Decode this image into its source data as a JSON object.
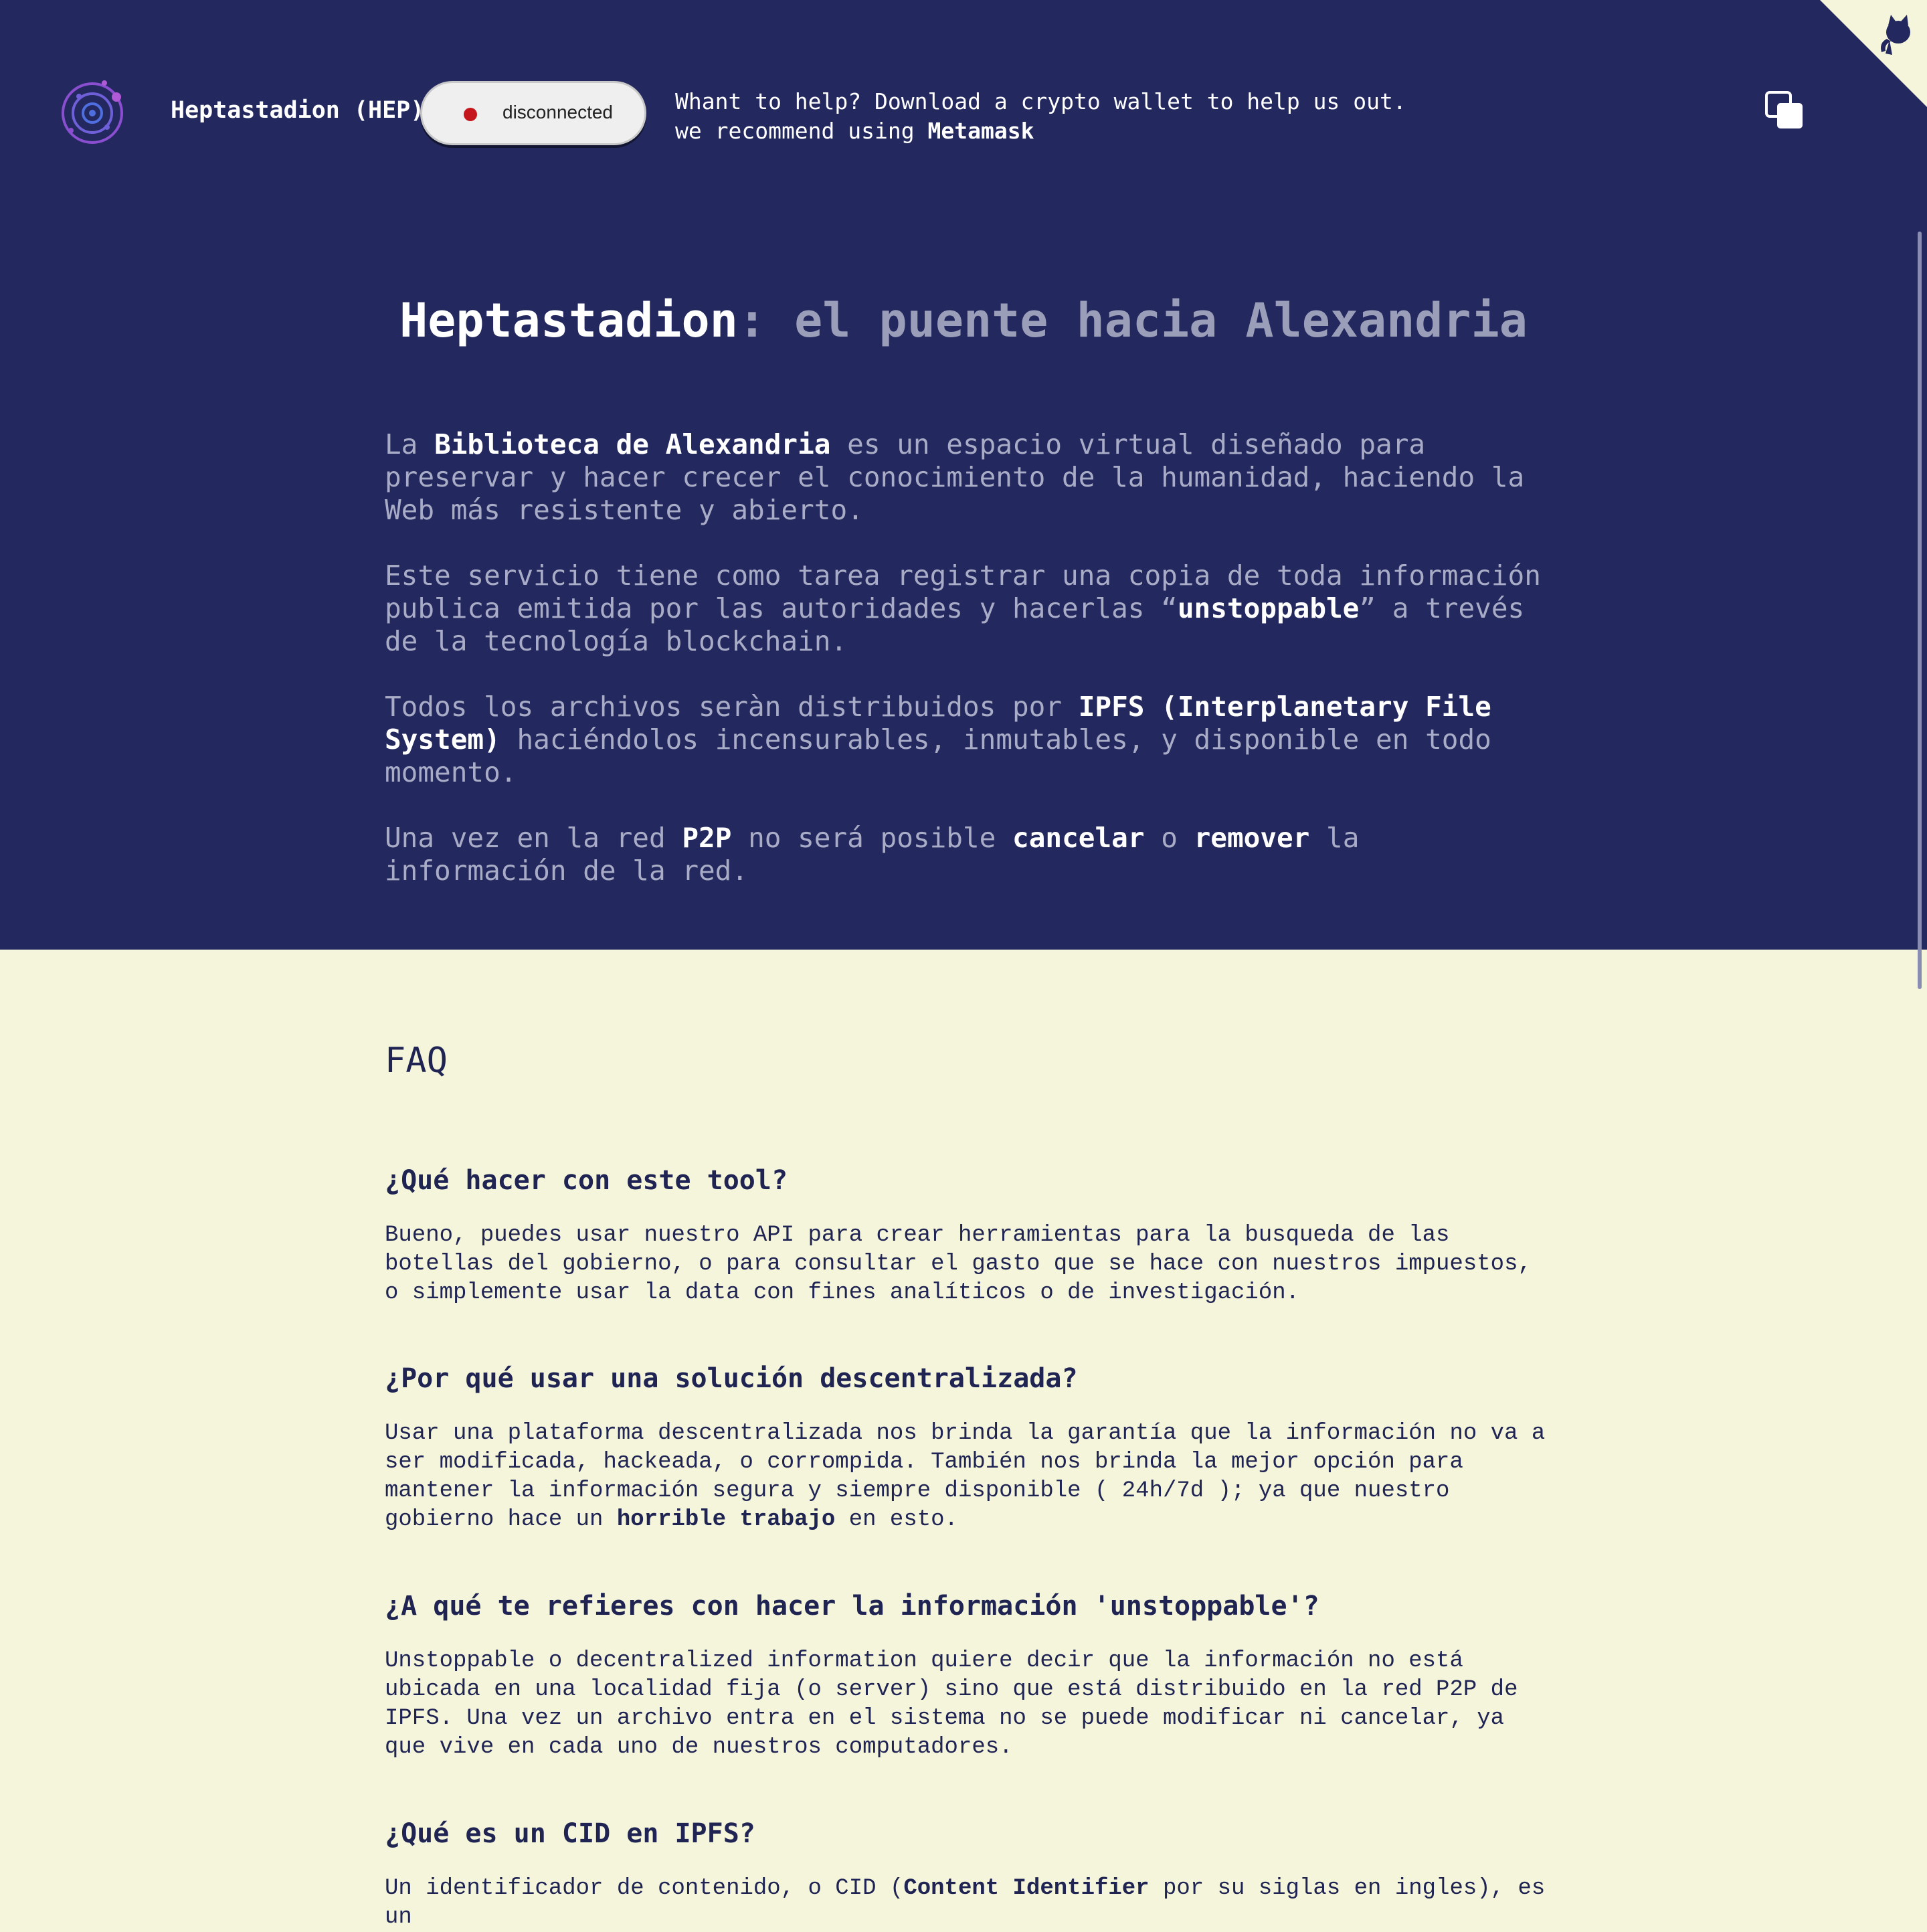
{
  "header": {
    "brand": "Heptastadion (HEP)",
    "status": "disconnected",
    "status_color": "#c4161c",
    "help_line1": "Whant to help? Download a crypto wallet to help us out.",
    "help_line2_prefix": "we recommend using ",
    "help_link": "Metamask",
    "copy_icon": "copy-icon",
    "corner_icon": "github-octocat-icon"
  },
  "hero": {
    "title_strong": "Heptastadion",
    "title_rest": ": el puente hacia Alexandria",
    "p1_pre": "La ",
    "p1_b": "Biblioteca de Alexandria",
    "p1_post": " es un espacio virtual diseñado para preservar y hacer crecer el conocimiento de la humanidad, haciendo la Web más resistente y abierto.",
    "p2_pre": "Este servicio tiene como tarea registrar una copia de toda información publica emitida por las autoridades y hacerlas “",
    "p2_b": "unstoppable",
    "p2_post": "” a trevés de la tecnología blockchain.",
    "p3_pre": "Todos los archivos seràn distribuidos por ",
    "p3_b": "IPFS (Interplanetary File System)",
    "p3_post": " haciéndolos incensurables, inmutables, y disponible en todo momento.",
    "p4_pre": "Una vez en la red ",
    "p4_b1": "P2P",
    "p4_mid1": " no será posible ",
    "p4_b2": "cancelar",
    "p4_mid2": " o ",
    "p4_b3": "remover",
    "p4_post": " la información de la red."
  },
  "faq": {
    "title": "FAQ",
    "q1": "¿Qué hacer con este tool?",
    "a1": "Bueno, puedes usar nuestro API para crear herramientas para la busqueda de las botellas del gobierno, o para consultar el gasto que se hace con nuestros impuestos, o simplemente usar la data con fines analíticos o de investigación.",
    "q2": "¿Por qué usar una solución descentralizada?",
    "a2_pre": "Usar una plataforma descentralizada nos brinda la garantía que la información no va a ser modificada, hackeada, o corrompida. También nos brinda la mejor opción para mantener la información segura y siempre disponible ( 24h/7d ); ya que nuestro gobierno hace un ",
    "a2_b": "horrible trabajo",
    "a2_post": " en esto.",
    "q3": "¿A qué te refieres con hacer la información 'unstoppable'?",
    "a3": "Unstoppable o decentralized information quiere decir que la información no está ubicada en una localidad fija (o server) sino que está distribuido en la red P2P de IPFS. Una vez un archivo entra en el sistema no se puede modificar ni cancelar, ya que vive en cada uno de nuestros computadores.",
    "q4": "¿Qué es un CID en IPFS?",
    "a4_pre": "Un identificador de contenido, o CID (",
    "a4_b": "Content Identifier",
    "a4_post": " por su siglas en ingles), es un"
  },
  "colors": {
    "hero_bg": "#23285e",
    "page_bg": "#f5f5dc",
    "faq_text": "#1f2453",
    "hero_text_dim": "#a9acc6"
  }
}
